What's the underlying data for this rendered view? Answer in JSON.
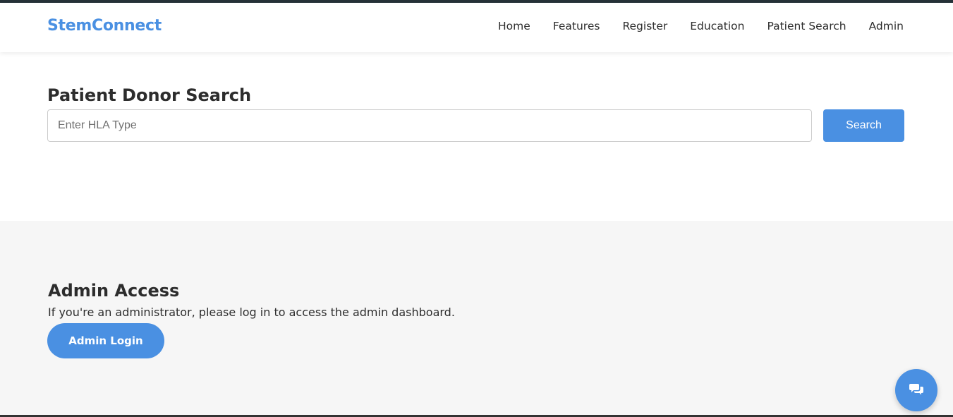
{
  "header": {
    "brand": "StemConnect",
    "nav": [
      "Home",
      "Features",
      "Register",
      "Education",
      "Patient Search",
      "Admin"
    ]
  },
  "search": {
    "title": "Patient Donor Search",
    "placeholder": "Enter HLA Type",
    "value": "",
    "button_label": "Search"
  },
  "admin": {
    "title": "Admin Access",
    "description": "If you're an administrator, please log in to access the admin dashboard.",
    "button_label": "Admin Login"
  },
  "chat": {
    "icon": "chat-bubbles-icon"
  },
  "colors": {
    "accent": "#4a90e2",
    "dark_strip": "#263238",
    "section_bg": "#f6f6f6",
    "text": "#2d2d2d"
  }
}
